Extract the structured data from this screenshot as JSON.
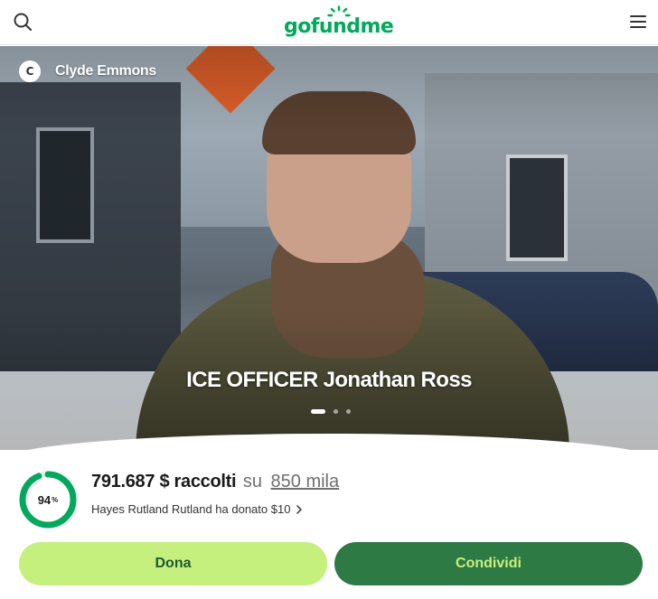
{
  "header": {
    "logo_text": "gofundme",
    "brand_color": "#02a95c",
    "search_icon": "search-icon",
    "menu_icon": "hamburger-menu-icon"
  },
  "hero": {
    "organizer_initial": "C",
    "organizer_name": "Clyde Emmons",
    "title": "ICE OFFICER Jonathan Ross",
    "slides": 3,
    "active_slide": 1
  },
  "progress": {
    "percent_value": 94,
    "percent_label": "94",
    "percent_sign": "%",
    "raised_text": "791.687 $ raccolti",
    "of_text": "su",
    "goal_text": "850 mila",
    "ring_color": "#02a95c"
  },
  "recent_donation": {
    "text": "Hayes Rutland Rutland ha donato $10"
  },
  "actions": {
    "donate_label": "Dona",
    "share_label": "Condividi",
    "donate_bg": "#c5f07e",
    "share_bg": "#2e7a45"
  }
}
